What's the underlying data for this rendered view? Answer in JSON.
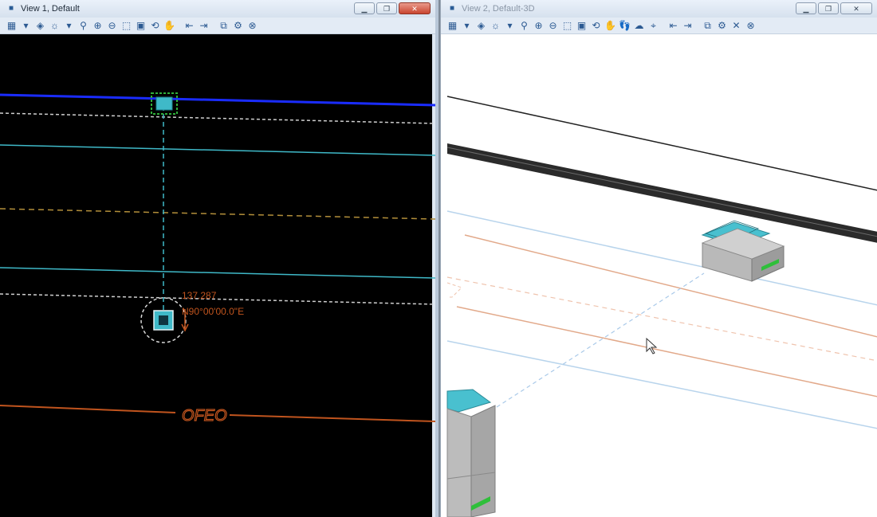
{
  "view1": {
    "title": "View 1, Default",
    "measure_distance": "137.287",
    "measure_bearing": "N90°00'00.0\"E",
    "line_tag": "OFEO",
    "buttons": {
      "minimize": "▁",
      "restore": "❐",
      "close": "✕"
    }
  },
  "view2": {
    "title": "View 2, Default-3D",
    "buttons": {
      "minimize": "▁",
      "restore": "❐",
      "close": "✕"
    }
  },
  "toolbar_icons": [
    "view-attributes-icon",
    "dropdown-icon",
    "display-style-icon",
    "lighting-icon",
    "dropdown-icon",
    "update-view-icon",
    "zoom-in-icon",
    "zoom-out-icon",
    "window-area-icon",
    "fit-view-icon",
    "rotate-view-icon",
    "pan-view-icon",
    "previous-view-icon",
    "next-view-icon",
    "copy-view-icon",
    "clip-volume-icon",
    "view-toggles-icon"
  ],
  "colors": {
    "canvas_dark": "#000000",
    "canvas_light": "#ffffff",
    "road_blue": "#1a2cff",
    "cyan": "#3fb9c8",
    "orange": "#c0541e",
    "white_dash": "#cfcfcf",
    "yellow_dash": "#b38f3a",
    "green_sel": "#2fae3a"
  }
}
